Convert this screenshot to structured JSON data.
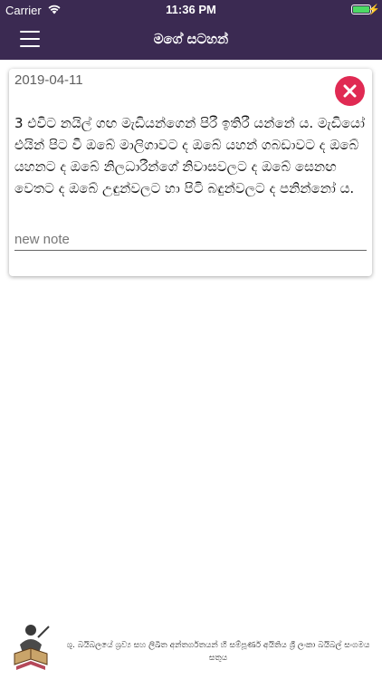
{
  "status_bar": {
    "carrier": "Carrier",
    "time": "11:36 PM",
    "wifi_icon": "wifi-icon",
    "battery_icon": "battery-icon",
    "battery_level": 1.0,
    "battery_color": "#4cd964"
  },
  "nav": {
    "title": "මගේ සටහන්",
    "menu_icon": "hamburger-menu-icon",
    "background": "#3b2a52"
  },
  "note": {
    "date": "2019-04-11",
    "close_icon": "close-icon",
    "close_color": "#e02a53",
    "text": " 3 එවිට නයිල් ගඟ මැඩියන්ගෙන් පිරී ඉතිරී යන්නේ ය. මැඩියෝ එයින් පිට වී ඔබේ මාලිගාවට ද ඔබේ යහන් ගබඩාවට ද ඔබේ යහනට ද ඔබේ නිලධාරීන්ගේ නිවාසවලට ද ඔබේ සෙනඟ වෙතට ද ඔබේ උඳුන්වලට හා පිටි බඳුන්වලට ද පනින්නෝ ය.",
    "input_placeholder": "new note",
    "input_value": ""
  },
  "footer": {
    "logo_icon": "bible-society-logo-icon",
    "text": "ශු. බයිබලයේ ශ්‍රව්‍ය සහ ලිඛිත අන්තර්ගතයන් හි සම්පූර්ණ අයිතිය ශ්‍රී ලංකා බයිබල් සංගමය සතුය"
  }
}
